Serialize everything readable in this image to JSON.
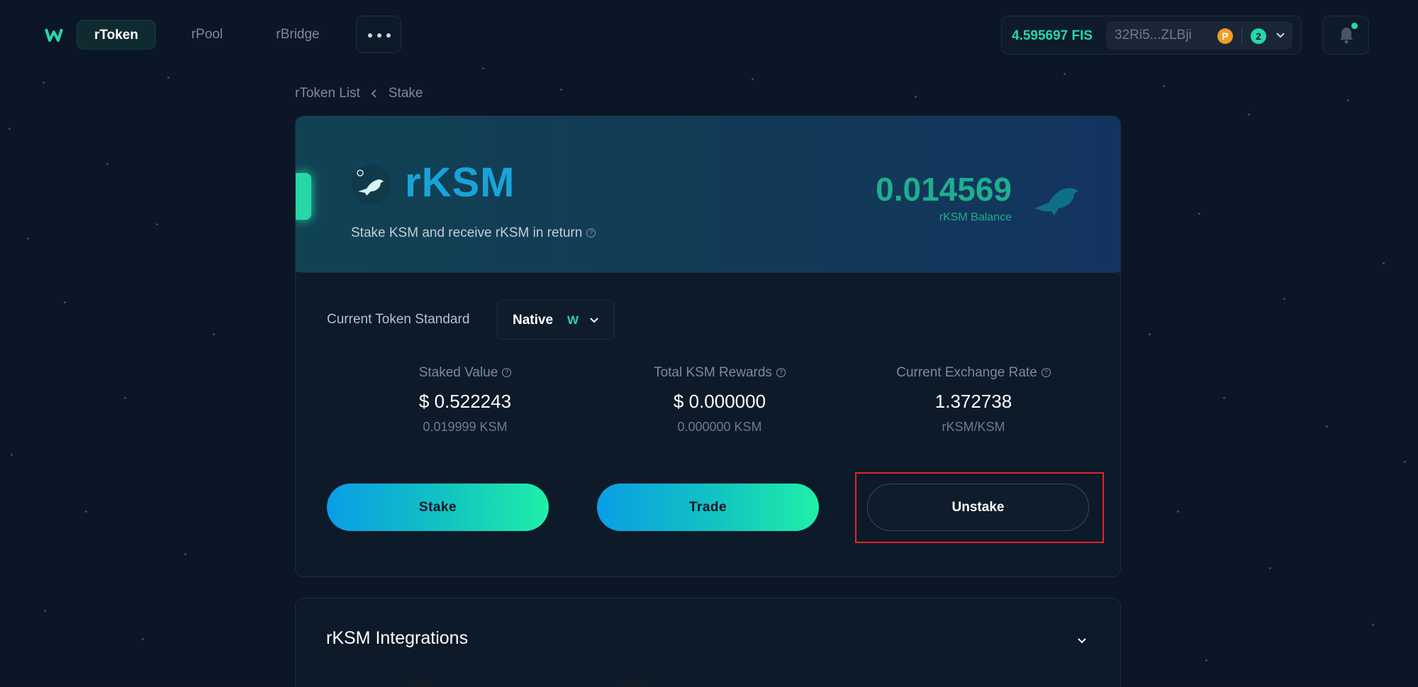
{
  "nav": {
    "tabs": [
      {
        "label": "rToken",
        "active": true
      },
      {
        "label": "rPool",
        "active": false
      },
      {
        "label": "rBridge",
        "active": false
      }
    ],
    "more_icon": "ellipsis-icon",
    "logo_icon": "stafi-logo-icon"
  },
  "wallet": {
    "fis_balance": "4.595697 FIS",
    "address": "32Ri5...ZLBji",
    "network_icon": "polkadot-icon",
    "account_count": "2"
  },
  "notifications": {
    "icon": "bell-icon",
    "has_unread": true
  },
  "breadcrumb": {
    "parent": "rToken List",
    "current": "Stake"
  },
  "hero": {
    "token_name": "rKSM",
    "subtitle": "Stake KSM and receive rKSM in return",
    "balance": "0.014569",
    "balance_label": "rKSM Balance"
  },
  "token_standard": {
    "label": "Current Token Standard",
    "value": "Native",
    "value_icon": "W"
  },
  "stats": [
    {
      "label": "Staked Value",
      "value": "$ 0.522243",
      "sub": "0.019999 KSM"
    },
    {
      "label": "Total KSM Rewards",
      "value": "$ 0.000000",
      "sub": "0.000000 KSM"
    },
    {
      "label": "Current Exchange Rate",
      "value": "1.372738",
      "sub": "rKSM/KSM"
    }
  ],
  "actions": {
    "stake": "Stake",
    "trade": "Trade",
    "unstake": "Unstake"
  },
  "integrations": {
    "title": "rKSM Integrations"
  },
  "colors": {
    "accent": "#26d8a7",
    "token_name": "#1aa3d8",
    "highlight": "#e0242d",
    "background": "#0b1626"
  }
}
